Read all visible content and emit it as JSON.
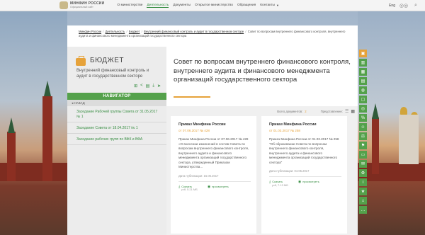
{
  "header": {
    "logo_title": "МИНФИН РОССИИ",
    "logo_subtitle": "Официальный сайт",
    "nav": [
      {
        "label": "О министерстве",
        "active": false
      },
      {
        "label": "Деятельность",
        "active": true
      },
      {
        "label": "Документы",
        "active": false
      },
      {
        "label": "Открытое министерство",
        "active": false
      },
      {
        "label": "Обращения",
        "active": false
      },
      {
        "label": "Контакты",
        "active": false
      }
    ],
    "lang": "Eng",
    "icons": [
      "glasses-icon",
      "search-icon"
    ]
  },
  "breadcrumb": {
    "items": [
      "Минфин России",
      "Деятельность",
      "Бюджет",
      "Внутренний финансовый контроль и аудит в государственном секторе",
      "Совет по вопросам внутреннего финансового контроля, внутреннего аудита и финансового менеджмента организаций государственного сектора"
    ]
  },
  "left": {
    "section_title": "БЮДЖЕТ",
    "section_subtitle": "Внутренний финансовый контроль и аудит в государственном секторе",
    "navigator": "НАВИГАТОР",
    "back": "НАЗАД",
    "links": [
      "Заседание Рабочей группы Совета от 31.05.2017 № 1",
      "Заседание Совета от 18.04.2017 № 1",
      "Заседание рабочих групп по ВФК и ВФА"
    ]
  },
  "main": {
    "title": "Совет по вопросам внутреннего финансового контроля, внутреннего аудита и финансового менеджмента организаций государственного сектора",
    "total_label": "Всего документов:",
    "total_count": "2",
    "view_label": "Представление:",
    "cards": [
      {
        "title": "Приказ Минфина России",
        "date": "от 07.06.2017 № 428",
        "body": "Приказ Минфина России от 07.06.2017 № 428 «О внесении изменений в состав Совета по вопросам внутреннего финансового контроля, внутреннего аудита и финансового менеджмента организаций государственного сектора, утвержденный Приказом Министерства...",
        "published": "Дата публикации: 15.06.2017",
        "download": "Скачать",
        "size": "pdf, 5.21 МБ",
        "view": "просмотреть"
      },
      {
        "title": "Приказ Минфина России",
        "date": "от 01.03.2017 № 258",
        "body": "Приказ Минфина России от 01.03.2017 № 258 \"Об образовании Совета по вопросам внутреннего финансового контроля, внутреннего аудита и финансового менеджмента организаций государственного сектора\"",
        "published": "Дата публикации: 04.05.2017",
        "download": "Скачать",
        "size": "pdf, 7.13 МБ",
        "view": "просмотреть"
      }
    ]
  },
  "colors": {
    "accent_green": "#54a14b",
    "accent_orange": "#e6a23a"
  }
}
